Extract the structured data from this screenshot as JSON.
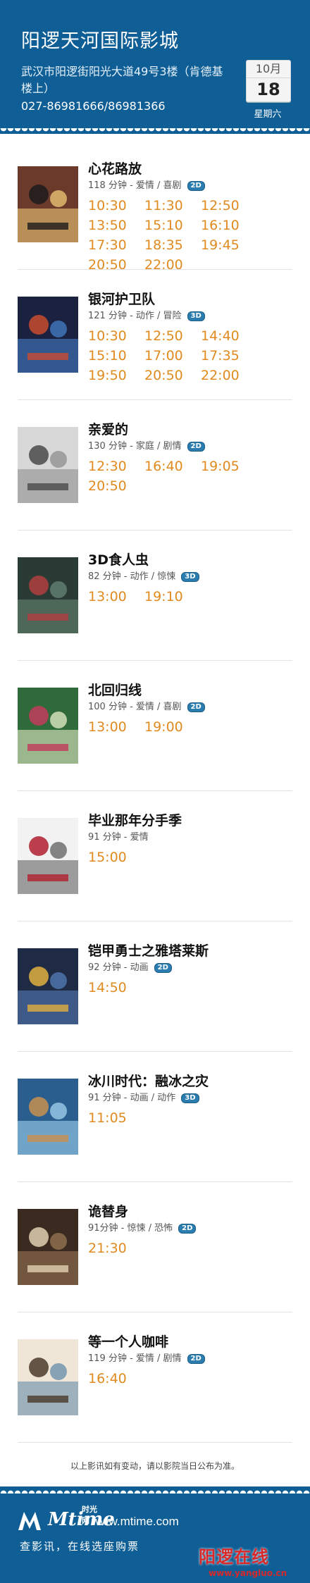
{
  "header": {
    "title": "阳逻天河国际影城",
    "address": "武汉市阳逻街阳光大道49号3楼（肯德基楼上）",
    "phone": "027-86981666/86981366",
    "date": {
      "month": "10月",
      "day": "18",
      "weekday": "星期六"
    }
  },
  "colors": {
    "brand_blue": "#0f5e96",
    "time_orange": "#e08a1f",
    "badge_blue": "#2b7db0",
    "watermark_red": "#d8282a"
  },
  "movies": [
    {
      "name": "心花路放",
      "meta": "118 分钟 - 爱情 / 喜剧",
      "format": "2D",
      "poster_icon": "movie-poster-image",
      "times": [
        "10:30",
        "11:30",
        "12:50",
        "13:50",
        "15:10",
        "16:10",
        "17:30",
        "18:35",
        "19:45",
        "20:50",
        "22:00"
      ]
    },
    {
      "name": "银河护卫队",
      "meta": "121 分钟 - 动作 / 冒险",
      "format": "3D",
      "poster_icon": "movie-poster-image",
      "times": [
        "10:30",
        "12:50",
        "14:40",
        "15:10",
        "17:00",
        "17:35",
        "19:50",
        "20:50",
        "22:00"
      ]
    },
    {
      "name": "亲爱的",
      "meta": "130 分钟 - 家庭 / 剧情",
      "format": "2D",
      "poster_icon": "movie-poster-image",
      "times": [
        "12:30",
        "16:40",
        "19:05",
        "20:50"
      ]
    },
    {
      "name": "3D食人虫",
      "meta": "82 分钟 - 动作 / 惊悚",
      "format": "3D",
      "poster_icon": "movie-poster-image",
      "times": [
        "13:00",
        "19:10"
      ]
    },
    {
      "name": "北回归线",
      "meta": "100 分钟 - 爱情 / 喜剧",
      "format": "2D",
      "poster_icon": "movie-poster-image",
      "times": [
        "13:00",
        "19:00"
      ]
    },
    {
      "name": "毕业那年分手季",
      "meta": "91 分钟 - 爱情",
      "format": "",
      "poster_icon": "movie-poster-image",
      "times": [
        "15:00"
      ]
    },
    {
      "name": "铠甲勇士之雅塔莱斯",
      "meta": "92 分钟 - 动画",
      "format": "2D",
      "poster_icon": "movie-poster-image",
      "times": [
        "14:50"
      ]
    },
    {
      "name": "冰川时代：融冰之灾",
      "meta": "91 分钟 - 动画 / 动作",
      "format": "3D",
      "poster_icon": "movie-poster-image",
      "times": [
        "11:05"
      ]
    },
    {
      "name": "诡替身",
      "meta": "91分钟 - 惊悚 / 恐怖",
      "format": "2D",
      "poster_icon": "movie-poster-image",
      "times": [
        "21:30"
      ]
    },
    {
      "name": "等一个人咖啡",
      "meta": "119 分钟 - 爱情 / 剧情",
      "format": "2D",
      "poster_icon": "movie-poster-image",
      "times": [
        "16:40"
      ]
    }
  ],
  "footnote": "以上影讯如有变动，请以影院当日公布为准。",
  "footer": {
    "logo_text": "Mtime",
    "logo_sub": "时光网",
    "site": "www.mtime.com",
    "slogan": "查影讯，在线选座购票"
  },
  "watermark": {
    "main": "阳逻在线",
    "url": "www.yangluo.cn"
  }
}
